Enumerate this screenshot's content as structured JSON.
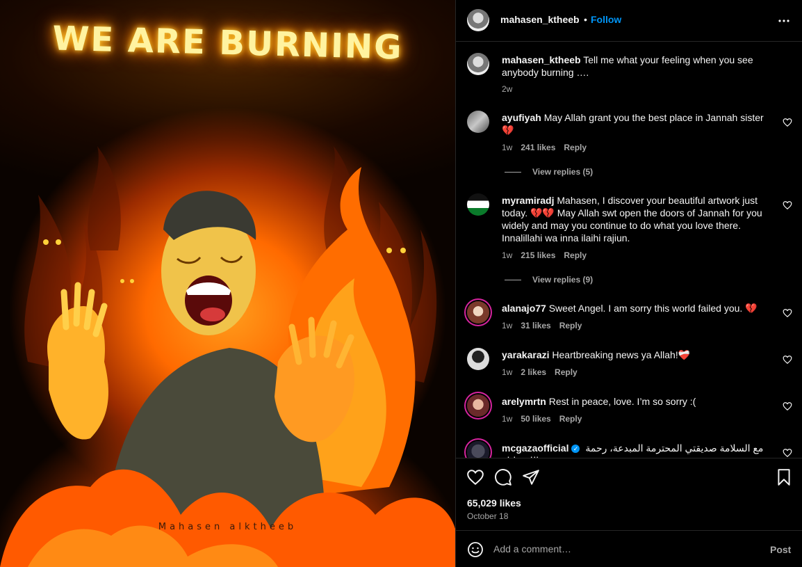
{
  "artwork": {
    "title": "WE ARE BURNING",
    "signature": "Mahasen alktheeb"
  },
  "header": {
    "username": "mahasen_ktheeb",
    "separator": "•",
    "follow_label": "Follow"
  },
  "caption": {
    "username": "mahasen_ktheeb",
    "text": "Tell me what your feeling when you see anybody burning ….",
    "time": "2w"
  },
  "comments": [
    {
      "username": "ayufiyah",
      "text": "May Allah grant you the best place in Jannah sister 💔",
      "time": "1w",
      "likes": "241 likes",
      "reply": "Reply",
      "view_replies": "View replies (5)"
    },
    {
      "username": "myramiradj",
      "text": "Mahasen, I discover your beautiful artwork just today. 💔💔 May Allah swt open the doors of Jannah for you widely and may you continue to do what you love there. Innalillahi wa inna ilaihi rajiun.",
      "time": "1w",
      "likes": "215 likes",
      "reply": "Reply",
      "view_replies": "View replies (9)"
    },
    {
      "username": "alanajo77",
      "text": "Sweet Angel. I am sorry this world failed you. 💔",
      "time": "1w",
      "likes": "31 likes",
      "reply": "Reply"
    },
    {
      "username": "yarakarazi",
      "text": "Heartbreaking news ya Allah!❤️‍🩹",
      "time": "1w",
      "likes": "2 likes",
      "reply": "Reply"
    },
    {
      "username": "arelymrtn",
      "text": "Rest in peace, love. I’m so sorry :(",
      "time": "1w",
      "likes": "50 likes",
      "reply": "Reply"
    },
    {
      "username": "mcgazaofficial",
      "verified_mark": "✓",
      "text": "مع السلامة صديقتي المحترمة المبدعة، رحمة الله عليكِ"
    }
  ],
  "post": {
    "likes": "65,029 likes",
    "date": "October 18"
  },
  "composer": {
    "placeholder": "Add a comment…",
    "post_label": "Post"
  },
  "icons": {
    "like": "heart-icon",
    "comment": "comment-icon",
    "share": "share-icon",
    "save": "bookmark-icon",
    "more": "more-icon",
    "emoji": "emoji-icon"
  },
  "colors": {
    "accent": "#0095f6",
    "muted": "#a8a8a8",
    "background": "#000000"
  }
}
